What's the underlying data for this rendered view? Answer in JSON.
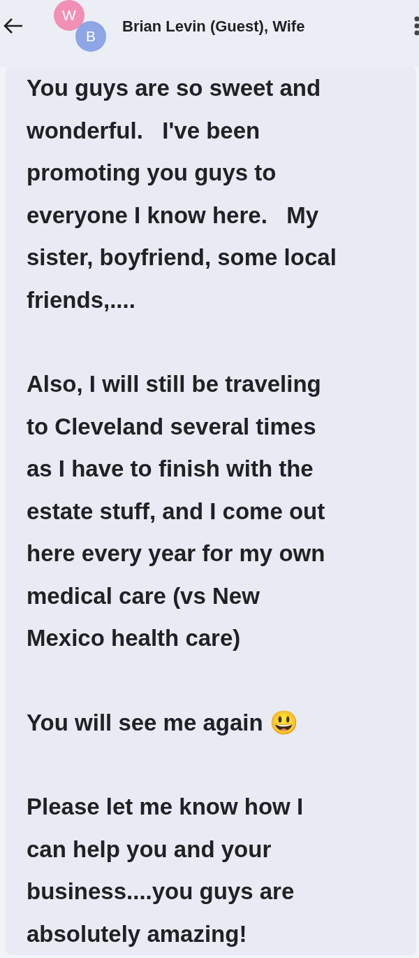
{
  "header": {
    "title": "Brian Levin (Guest), Wife",
    "avatars": [
      {
        "initial": "W",
        "color": "#f28fb4"
      },
      {
        "initial": "B",
        "color": "#8ea6e6"
      }
    ]
  },
  "message": {
    "paragraphs": [
      [
        "You guys are so sweet and",
        "wonderful.   I've been",
        "promoting you guys to",
        "everyone I know here.   My",
        "sister, boyfriend, some local",
        "friends,...."
      ],
      [
        "Also, I will still be traveling",
        "to Cleveland several times",
        "as I have to finish with the",
        "estate stuff, and I come out",
        "here every year for my own",
        "medical care (vs New",
        "Mexico health care)"
      ],
      [
        "You will see me again 😃"
      ],
      [
        "Please let me know how I",
        "can help you and your",
        "business....you guys are",
        "absolutely amazing!"
      ]
    ]
  }
}
